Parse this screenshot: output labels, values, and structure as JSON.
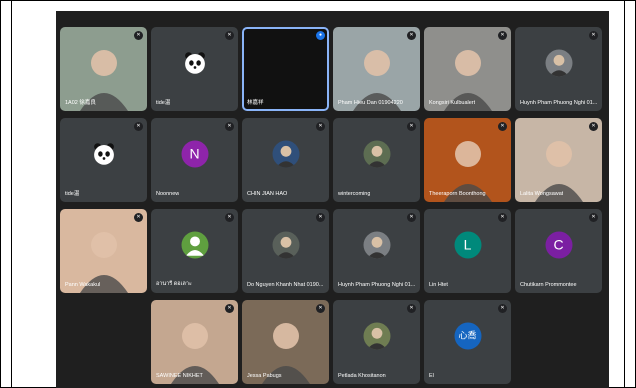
{
  "participants": [
    {
      "name": "1A02 徐嘉良",
      "type": "video",
      "bg": "#8d9d8f"
    },
    {
      "name": "tide温",
      "type": "panda"
    },
    {
      "name": "林嘉祥",
      "type": "active"
    },
    {
      "name": "Pham Hieu Dan 01904220",
      "type": "video",
      "bg": "#9aa5a7"
    },
    {
      "name": "Kongsiri Kulbualert",
      "type": "video",
      "bg": "#8f8f8c"
    },
    {
      "name": "Huynh Pham Phuong Nghi 01...",
      "type": "photo",
      "bg": "#7b7f83"
    },
    {
      "name": "tide温",
      "type": "panda"
    },
    {
      "name": "Noonnew",
      "type": "letter",
      "letter": "N",
      "color": "#8e24aa"
    },
    {
      "name": "CHIN JIAN HAO",
      "type": "photo",
      "bg": "#2f4f7a"
    },
    {
      "name": "wintercoming",
      "type": "photo",
      "bg": "#5d6d52"
    },
    {
      "name": "Theeraporn Boonthong",
      "type": "video",
      "bg": "#b2541c"
    },
    {
      "name": "Lalita Wongsawat",
      "type": "video",
      "bg": "#c7b6a6"
    },
    {
      "name": "Pann Wakakul",
      "type": "video",
      "bg": "#d9b89f"
    },
    {
      "name": "อานารี ดอเลาะ",
      "type": "generic"
    },
    {
      "name": "Do Nguyen Khanh Nhat 0190...",
      "type": "photo",
      "bg": "#59605a"
    },
    {
      "name": "Huynh Pham Phuong Nghi 01...",
      "type": "photo",
      "bg": "#7b7f83"
    },
    {
      "name": "Lin Htet",
      "type": "letter",
      "letter": "L",
      "color": "#00897b"
    },
    {
      "name": "Chutikarn Prommontee",
      "type": "letter",
      "letter": "C",
      "color": "#7b1fa2"
    },
    {
      "name": "SAWINEE NIKHET",
      "type": "video",
      "bg": "#c4a790"
    },
    {
      "name": "Jessa Pabugs",
      "type": "video",
      "bg": "#7b6a58"
    },
    {
      "name": "Petlada Khositanon",
      "type": "photo",
      "bg": "#6f7d52"
    },
    {
      "name": "El",
      "type": "text",
      "letter": "心喬",
      "color": "#1565c0"
    }
  ]
}
